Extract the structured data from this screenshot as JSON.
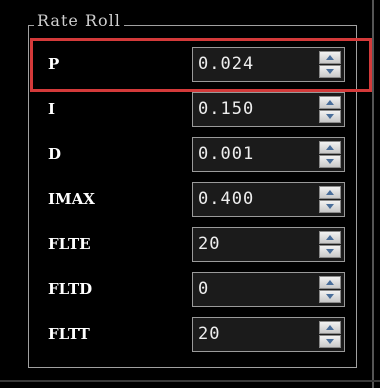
{
  "group": {
    "title": "Rate Roll"
  },
  "rows": [
    {
      "label": "P",
      "value": "0.024"
    },
    {
      "label": "I",
      "value": "0.150"
    },
    {
      "label": "D",
      "value": "0.001"
    },
    {
      "label": "IMAX",
      "value": "0.400"
    },
    {
      "label": "FLTE",
      "value": "20"
    },
    {
      "label": "FLTD",
      "value": "0"
    },
    {
      "label": "FLTT",
      "value": "20"
    }
  ],
  "highlight": {
    "row_label": "P",
    "color": "#d43a3a"
  },
  "icons": {
    "up": "spin-up-arrow-icon",
    "down": "spin-down-arrow-icon"
  },
  "colors": {
    "background": "#000000",
    "field_background": "#1b1b1b",
    "field_border": "#9a9a9a",
    "arrow": "#4a6e9a"
  }
}
